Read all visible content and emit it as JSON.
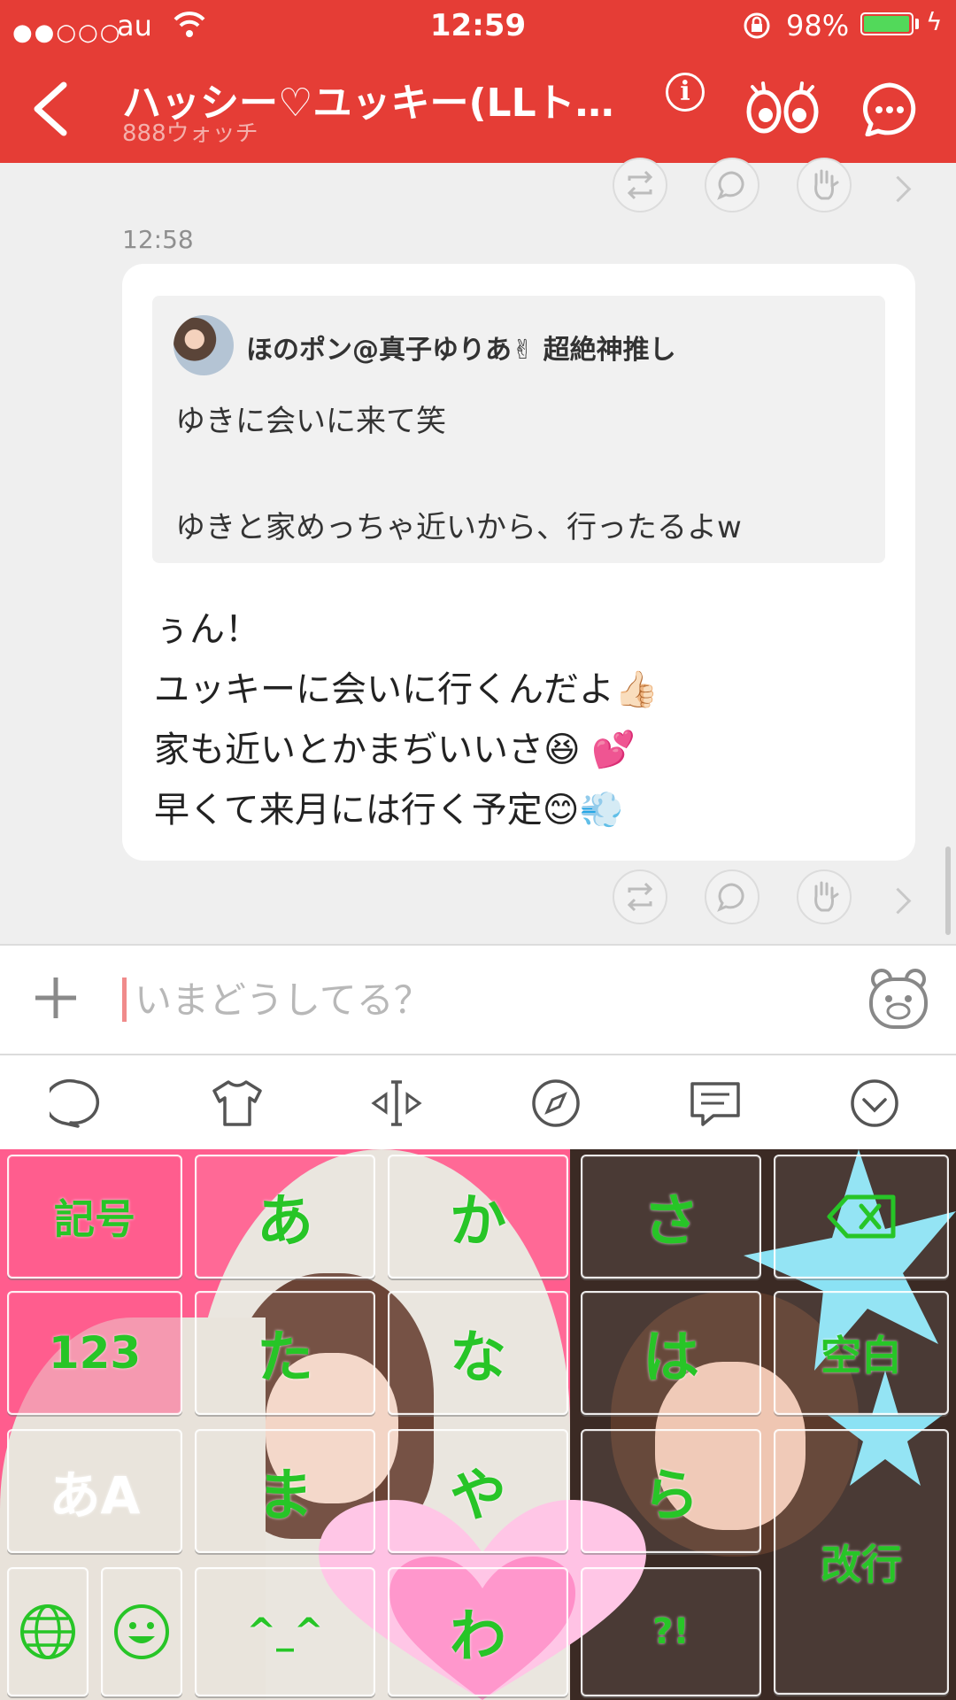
{
  "status": {
    "carrier": "au",
    "signal": "●●○○○",
    "time": "12:59",
    "battery": "98%",
    "battery_level": 0.98
  },
  "header": {
    "title": "ハッシー♡ユッキー(LLトー…",
    "subtitle": "888ウォッチ",
    "info": "i",
    "colors": {
      "bar": "#e53d36"
    }
  },
  "chat": {
    "time": "12:58",
    "quote": {
      "author": "ほのポン@真子ゆりあ✌ 超絶神推し",
      "lines": [
        "ゆきに会いに来て笑",
        "ゆきと家めっちゃ近いから、行ったるよw"
      ]
    },
    "lines": [
      "ぅん！",
      "ユッキーに会いに行くんだよ👍🏻",
      "家も近いとかまぢいいさ😆 💕",
      "早くて来月には行く予定😊💨"
    ]
  },
  "input": {
    "placeholder": "いまどうしてる？"
  },
  "toolbar": [
    "bubble-icon",
    "tshirt-icon",
    "resize-icon",
    "compass-icon",
    "message-icon",
    "collapse-icon"
  ],
  "keyboard": {
    "symbols": "記号",
    "numbers": "123",
    "mode": "あA",
    "space": "空白",
    "enter": "改行",
    "kana": [
      "あ",
      "か",
      "さ",
      "た",
      "な",
      "は",
      "ま",
      "や",
      "ら",
      "^_^",
      "わ",
      "?!"
    ],
    "key_color": "#27c527"
  }
}
